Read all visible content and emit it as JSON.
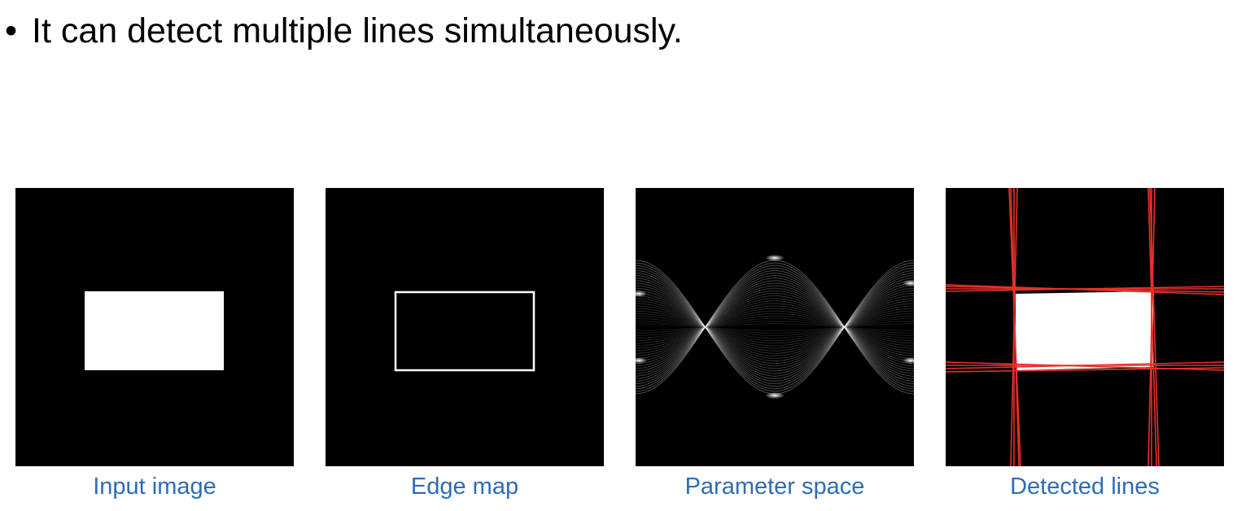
{
  "slide": {
    "bullet": "•",
    "text": "It can detect multiple lines simultaneously."
  },
  "panels": [
    {
      "caption": "Input image"
    },
    {
      "caption": "Edge map"
    },
    {
      "caption": "Parameter space"
    },
    {
      "caption": "Detected lines"
    }
  ],
  "colors": {
    "caption": "#2e6db5",
    "detected_line": "#e8302a",
    "panel_background": "#000000",
    "foreground": "#ffffff"
  }
}
